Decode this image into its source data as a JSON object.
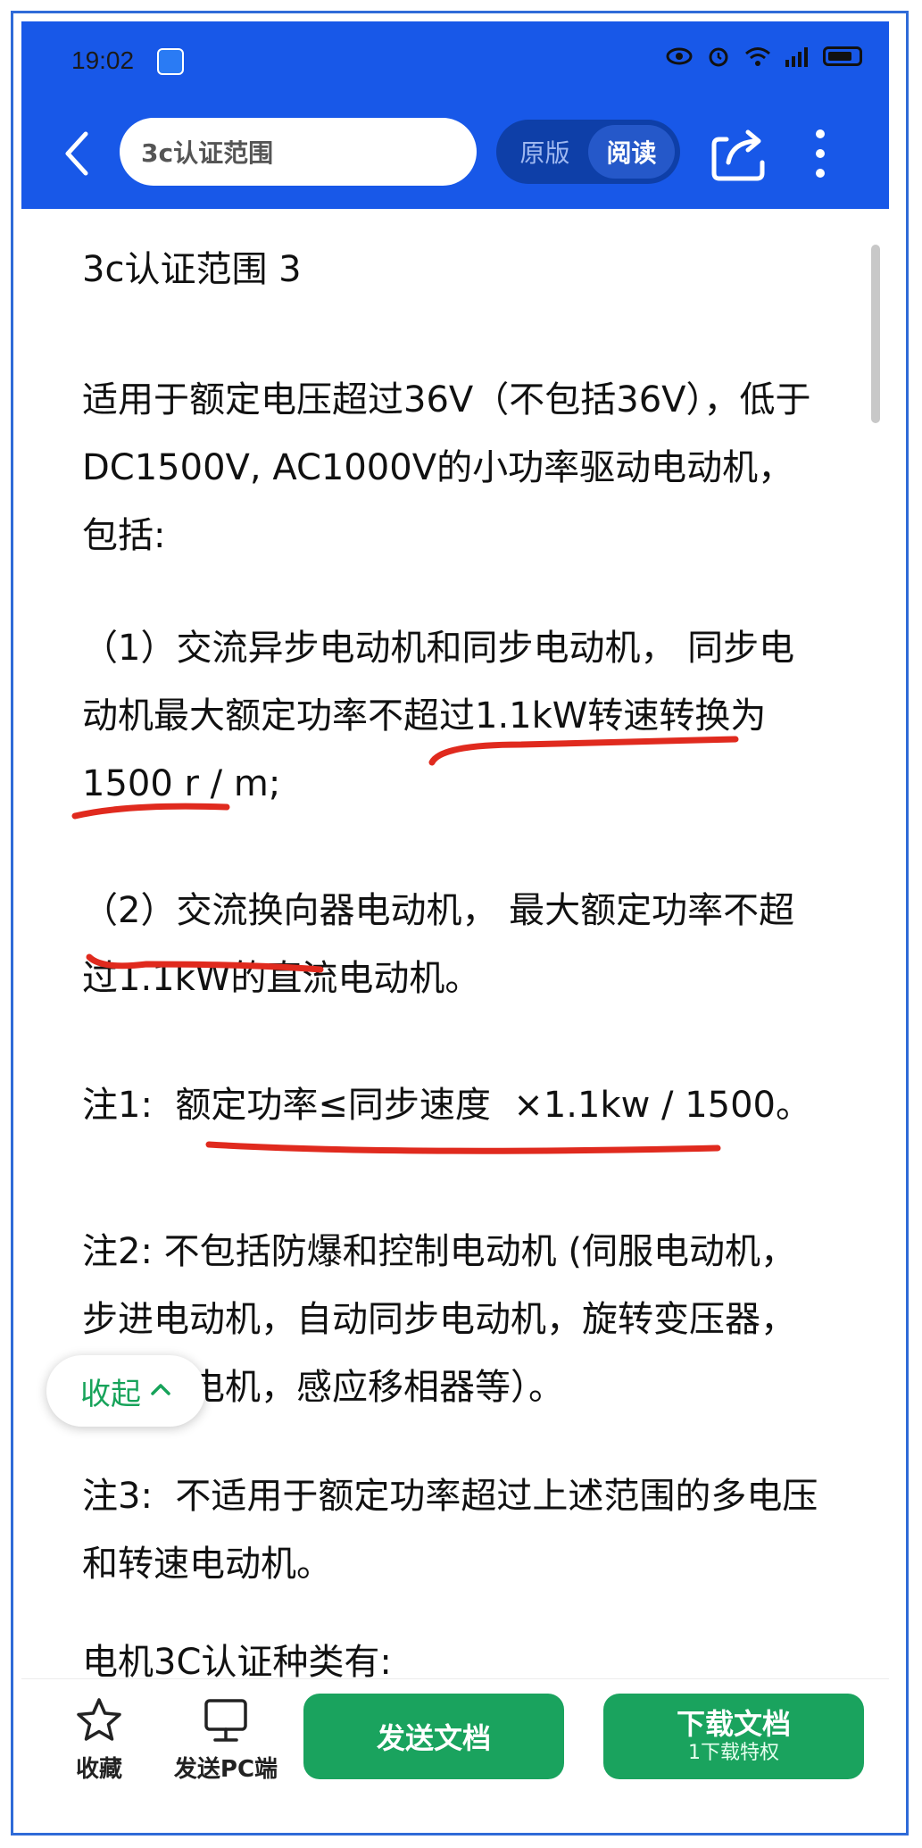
{
  "status_bar": {
    "time": "19:02"
  },
  "header": {
    "search_text": "3c认证范围",
    "toggle": {
      "original": "原版",
      "reading": "阅读"
    }
  },
  "document": {
    "title": "3c认证范围 3",
    "paragraphs": [
      "适用于额定电压超过36V（不包括36V），低于DC1500V, AC1000V的小功率驱动电动机，包括:",
      "（1）交流异步电动机和同步电动机， 同步电动机最大额定功率不超过1.1kW转速转换为1500 r / m;",
      "（2）交流换向器电动机， 最大额定功率不超过1.1kW的直流电动机。",
      "注1:  额定功率≤同步速度  ×1.1kw / 1500。",
      "注2: 不包括防爆和控制电动机 (伺服电动机，步进电动机，自动同步电动机，旋转变压器，速度发电机，感应移相器等）。",
      "注3:  不适用于额定功率超过上述范围的多电压和转速电动机。",
      "电机3C认证种类有:"
    ]
  },
  "collapse_button": "收起",
  "bottom_bar": {
    "favorite": "收藏",
    "send_pc": "发送PC端",
    "send_doc": "发送文档",
    "download": "下载文档",
    "download_sub": "1下载特权"
  },
  "colors": {
    "header_bg": "#1858e8",
    "accent_green": "#1aa35e",
    "annotation_red": "#e02a1e"
  }
}
